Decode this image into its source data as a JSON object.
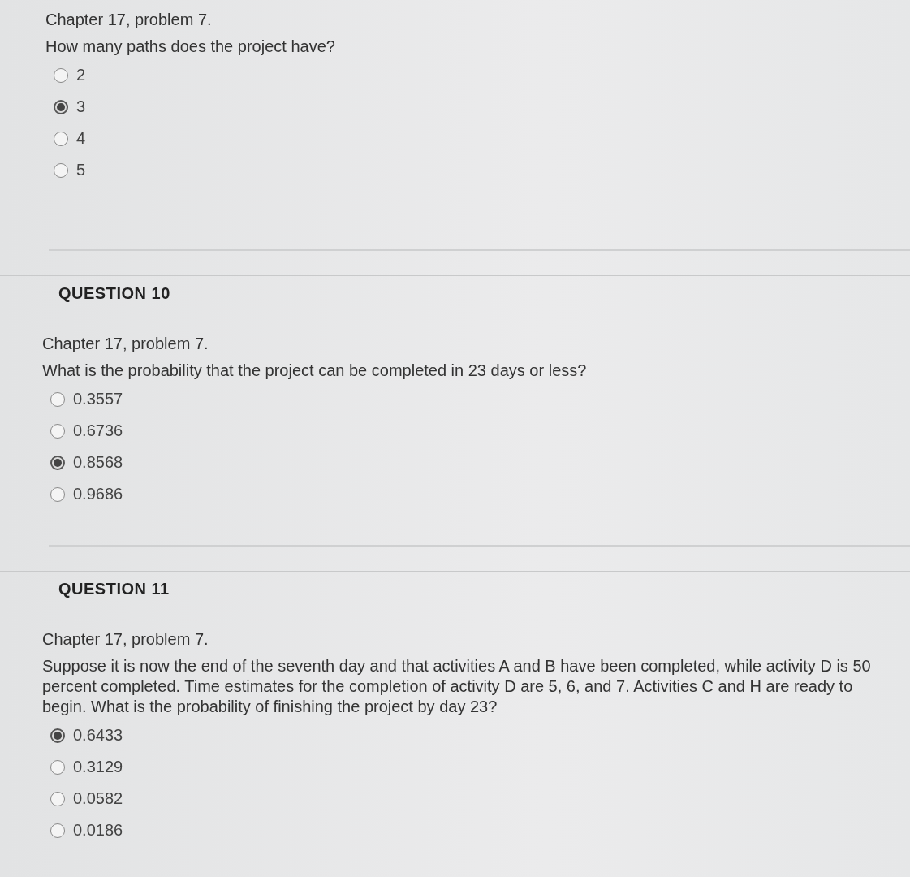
{
  "questions": [
    {
      "source": "Chapter 17, problem 7.",
      "prompt": "How many paths does the project have?",
      "options": [
        {
          "label": "2",
          "selected": false
        },
        {
          "label": "3",
          "selected": true
        },
        {
          "label": "4",
          "selected": false
        },
        {
          "label": "5",
          "selected": false
        }
      ]
    },
    {
      "heading": "QUESTION 10",
      "source": "Chapter 17, problem 7.",
      "prompt": "What is the probability that the project can be completed in 23 days or less?",
      "options": [
        {
          "label": "0.3557",
          "selected": false
        },
        {
          "label": "0.6736",
          "selected": false
        },
        {
          "label": "0.8568",
          "selected": true
        },
        {
          "label": "0.9686",
          "selected": false
        }
      ]
    },
    {
      "heading": "QUESTION 11",
      "source": "Chapter 17, problem 7.",
      "prompt": "Suppose it is now the end of the seventh day and that activities A and B have been completed, while activity D is 50 percent completed. Time estimates for the completion of activity D are 5, 6, and 7. Activities C and H are ready to begin. What is the probability of finishing the project by day 23?",
      "options": [
        {
          "label": "0.6433",
          "selected": true
        },
        {
          "label": "0.3129",
          "selected": false
        },
        {
          "label": "0.0582",
          "selected": false
        },
        {
          "label": "0.0186",
          "selected": false
        }
      ]
    }
  ]
}
